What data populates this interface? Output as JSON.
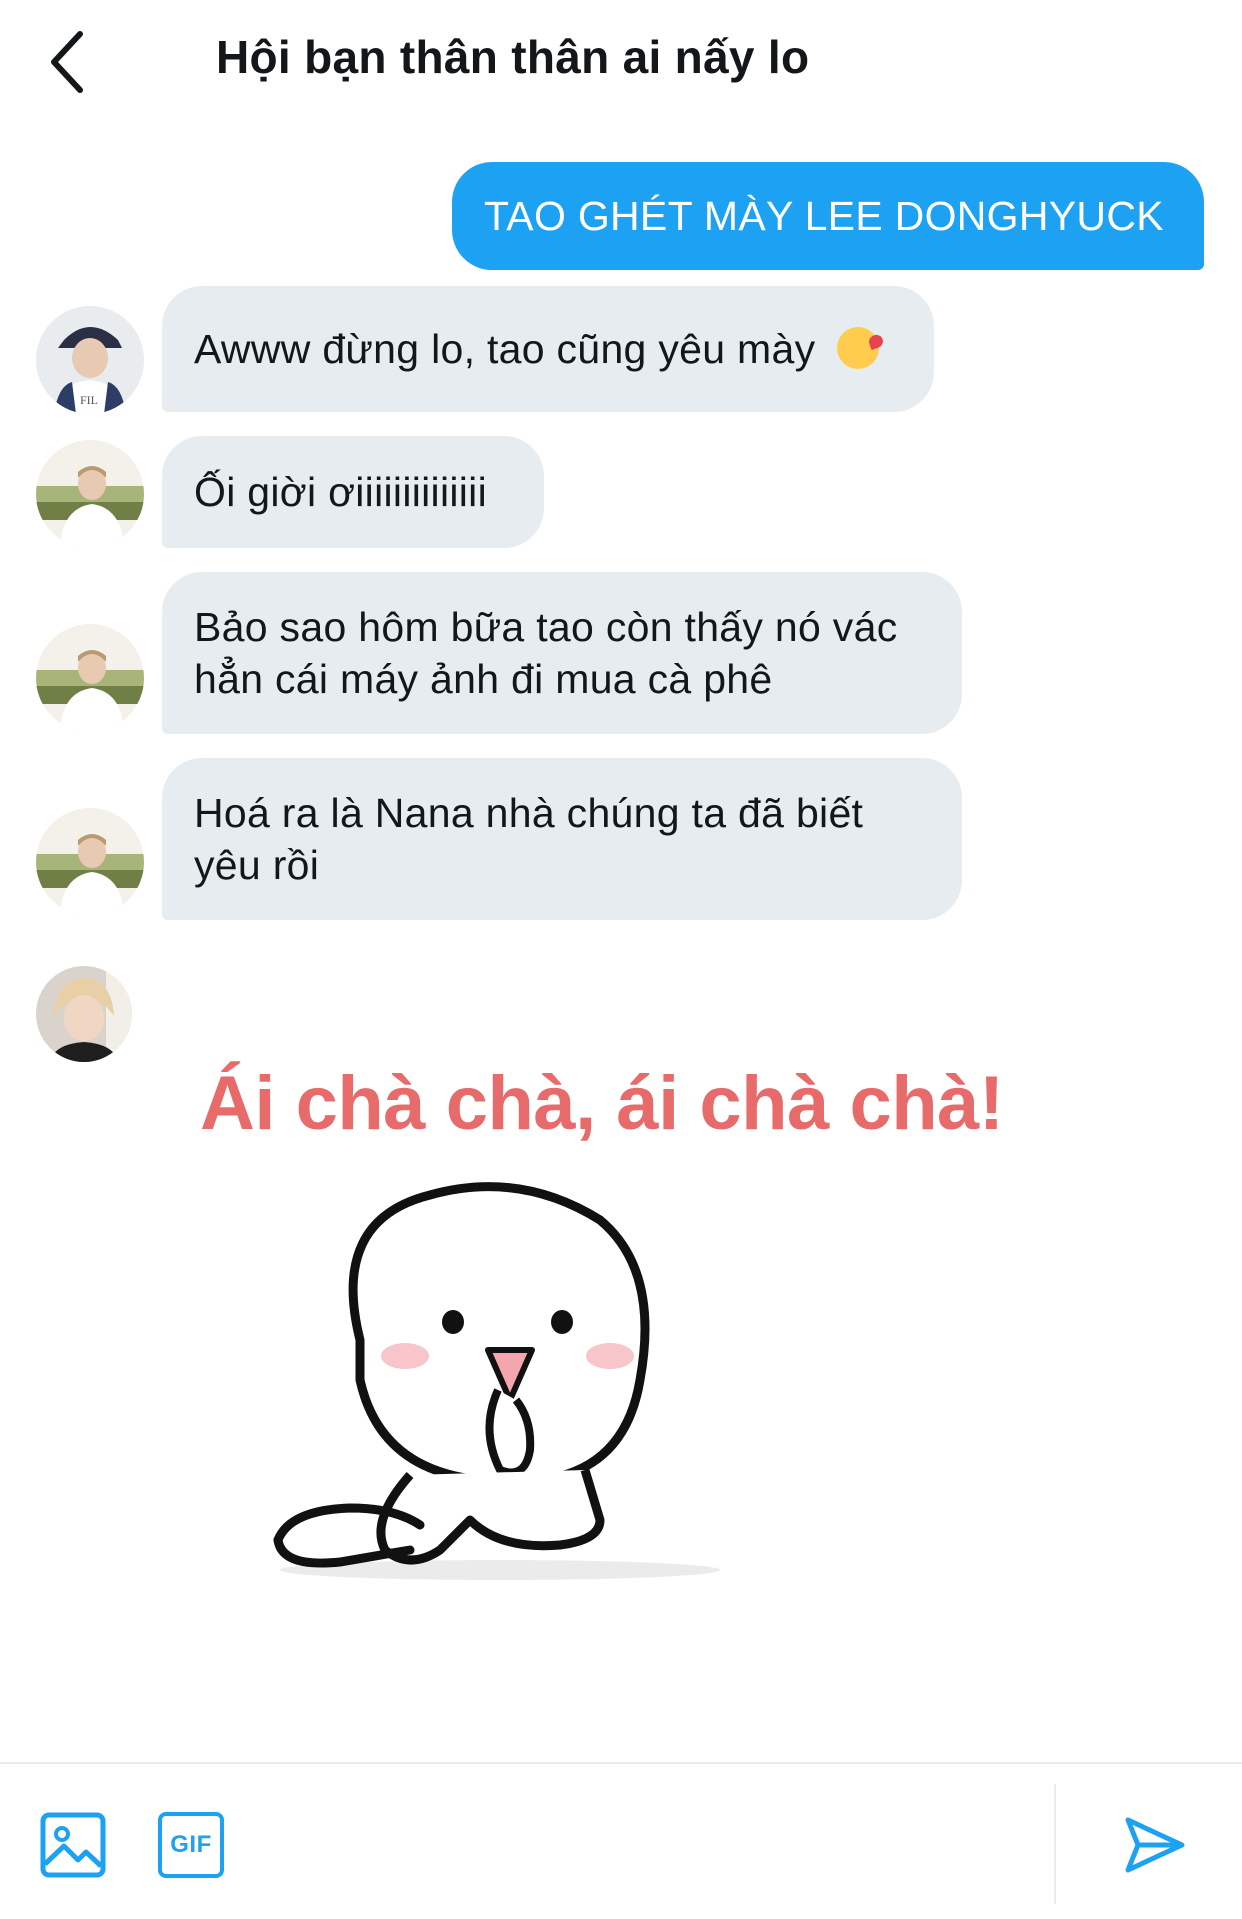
{
  "header": {
    "title": "Hội bạn thân thân ai nấy lo",
    "back_icon": "chevron-left-icon"
  },
  "messages": [
    {
      "direction": "outgoing",
      "text": "TAO GHÉT MÀY LEE DONGHYUCK"
    },
    {
      "direction": "incoming",
      "text": "Awww đừng lo, tao cũng yêu mày",
      "emoji": "kissing-heart-emoji"
    },
    {
      "direction": "incoming",
      "text": "Ối giời ơiiiiiiiiiiiiii"
    },
    {
      "direction": "incoming",
      "text_line1": "Bảo sao hôm bữa tao còn thấy nó vác",
      "text_line2": "hẳn cái máy ảnh đi mua cà phê"
    },
    {
      "direction": "incoming",
      "text_line1": "Hoá ra là Nana nhà chúng ta đã biết",
      "text_line2": "yêu rồi"
    },
    {
      "direction": "incoming",
      "type": "sticker",
      "caption": "Ái chà chà, ái chà chà!"
    }
  ],
  "composer": {
    "image_icon": "image-icon",
    "gif_label": "GIF",
    "send_icon": "send-icon"
  },
  "colors": {
    "accent": "#1da1f2",
    "incoming_bubble": "#e6ecf0",
    "sticker_text": "#e86b6b"
  }
}
